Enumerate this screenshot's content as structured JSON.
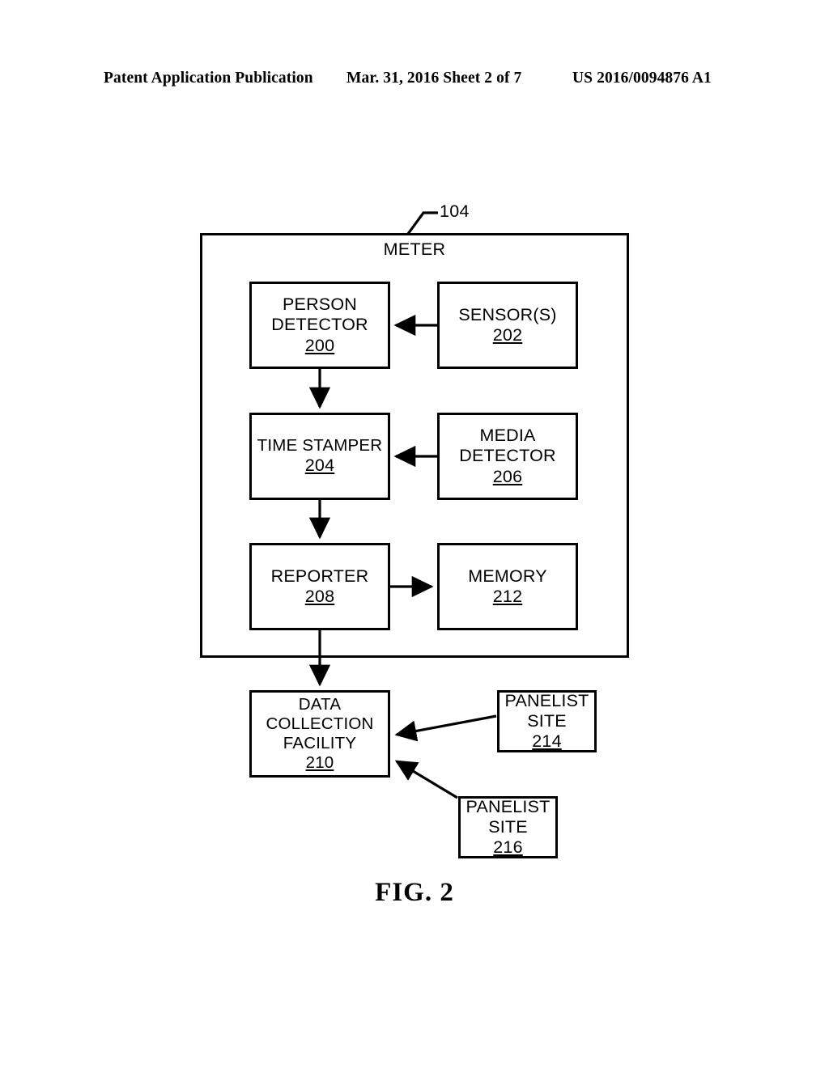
{
  "header": {
    "left": "Patent Application Publication",
    "middle": "Mar. 31, 2016  Sheet 2 of 7",
    "right": "US 2016/0094876 A1"
  },
  "figure": {
    "caption": "FIG.  2",
    "callout_ref": "104",
    "container_title": "METER",
    "nodes": [
      {
        "id": "person",
        "lines": [
          "PERSON",
          "DETECTOR"
        ],
        "ref": "200"
      },
      {
        "id": "sensors",
        "lines": [
          "SENSOR(S)"
        ],
        "ref": "202"
      },
      {
        "id": "time",
        "lines": [
          "TIME STAMPER"
        ],
        "ref": "204"
      },
      {
        "id": "media",
        "lines": [
          "MEDIA",
          "DETECTOR"
        ],
        "ref": "206"
      },
      {
        "id": "reporter",
        "lines": [
          "REPORTER"
        ],
        "ref": "208"
      },
      {
        "id": "memory",
        "lines": [
          "MEMORY"
        ],
        "ref": "212"
      },
      {
        "id": "dcf",
        "lines": [
          "DATA",
          "COLLECTION",
          "FACILITY"
        ],
        "ref": "210"
      },
      {
        "id": "site214",
        "lines": [
          "PANELIST",
          "SITE"
        ],
        "ref": "214"
      },
      {
        "id": "site216",
        "lines": [
          "PANELIST",
          "SITE"
        ],
        "ref": "216"
      }
    ],
    "connections": [
      {
        "from": "sensors",
        "to": "person",
        "direction": "left"
      },
      {
        "from": "person",
        "to": "time",
        "direction": "down"
      },
      {
        "from": "media",
        "to": "time",
        "direction": "left"
      },
      {
        "from": "time",
        "to": "reporter",
        "direction": "down"
      },
      {
        "from": "reporter",
        "to": "memory",
        "direction": "right"
      },
      {
        "from": "reporter",
        "to": "dcf",
        "direction": "down"
      },
      {
        "from": "site214",
        "to": "dcf",
        "direction": "diagonal-left"
      },
      {
        "from": "site216",
        "to": "dcf",
        "direction": "diagonal-up-left"
      }
    ]
  },
  "style": {
    "ink": "#000000",
    "paper": "#ffffff"
  }
}
